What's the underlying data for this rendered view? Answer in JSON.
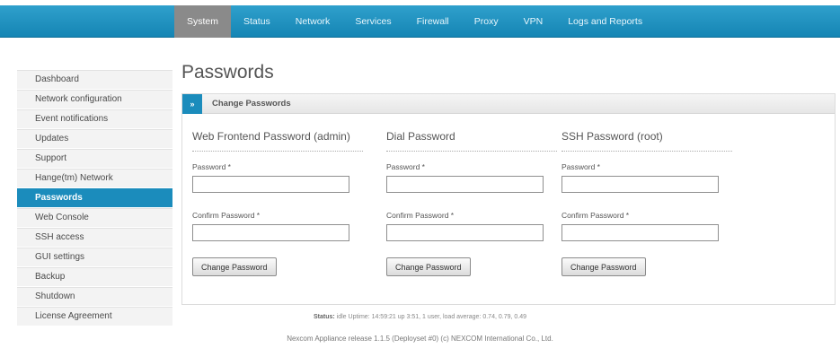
{
  "nav": {
    "tabs": [
      {
        "label": "System",
        "active": true
      },
      {
        "label": "Status"
      },
      {
        "label": "Network"
      },
      {
        "label": "Services"
      },
      {
        "label": "Firewall"
      },
      {
        "label": "Proxy"
      },
      {
        "label": "VPN"
      },
      {
        "label": "Logs and Reports"
      }
    ]
  },
  "sidebar": {
    "items": [
      {
        "label": "Dashboard"
      },
      {
        "label": "Network configuration"
      },
      {
        "label": "Event notifications"
      },
      {
        "label": "Updates"
      },
      {
        "label": "Support"
      },
      {
        "label": "Hange(tm) Network"
      },
      {
        "label": "Passwords",
        "active": true
      },
      {
        "label": "Web Console"
      },
      {
        "label": "SSH access"
      },
      {
        "label": "GUI settings"
      },
      {
        "label": "Backup"
      },
      {
        "label": "Shutdown"
      },
      {
        "label": "License Agreement"
      }
    ]
  },
  "page": {
    "title": "Passwords",
    "panel_title": "Change Passwords",
    "collapse_glyph": "»"
  },
  "columns": [
    {
      "heading": "Web Frontend Password (admin)",
      "password_label": "Password *",
      "confirm_label": "Confirm Password *",
      "password_value": "",
      "confirm_value": "",
      "button_label": "Change Password"
    },
    {
      "heading": "Dial Password",
      "password_label": "Password *",
      "confirm_label": "Confirm Password *",
      "password_value": "",
      "confirm_value": "",
      "button_label": "Change Password"
    },
    {
      "heading": "SSH Password (root)",
      "password_label": "Password *",
      "confirm_label": "Confirm Password *",
      "password_value": "",
      "confirm_value": "",
      "button_label": "Change Password"
    }
  ],
  "status": {
    "label": "Status:",
    "text": "idle Uptime: 14:59:21 up 3:51, 1 user, load average: 0.74, 0.79, 0.49"
  },
  "footer": {
    "text": "Nexcom Appliance release 1.1.5 (Deployset #0) (c) NEXCOM International Co., Ltd."
  },
  "colors": {
    "accent": "#1b8cbc",
    "nav_bar": "#1c8dbd",
    "active_tab": "#8a8a8a"
  }
}
